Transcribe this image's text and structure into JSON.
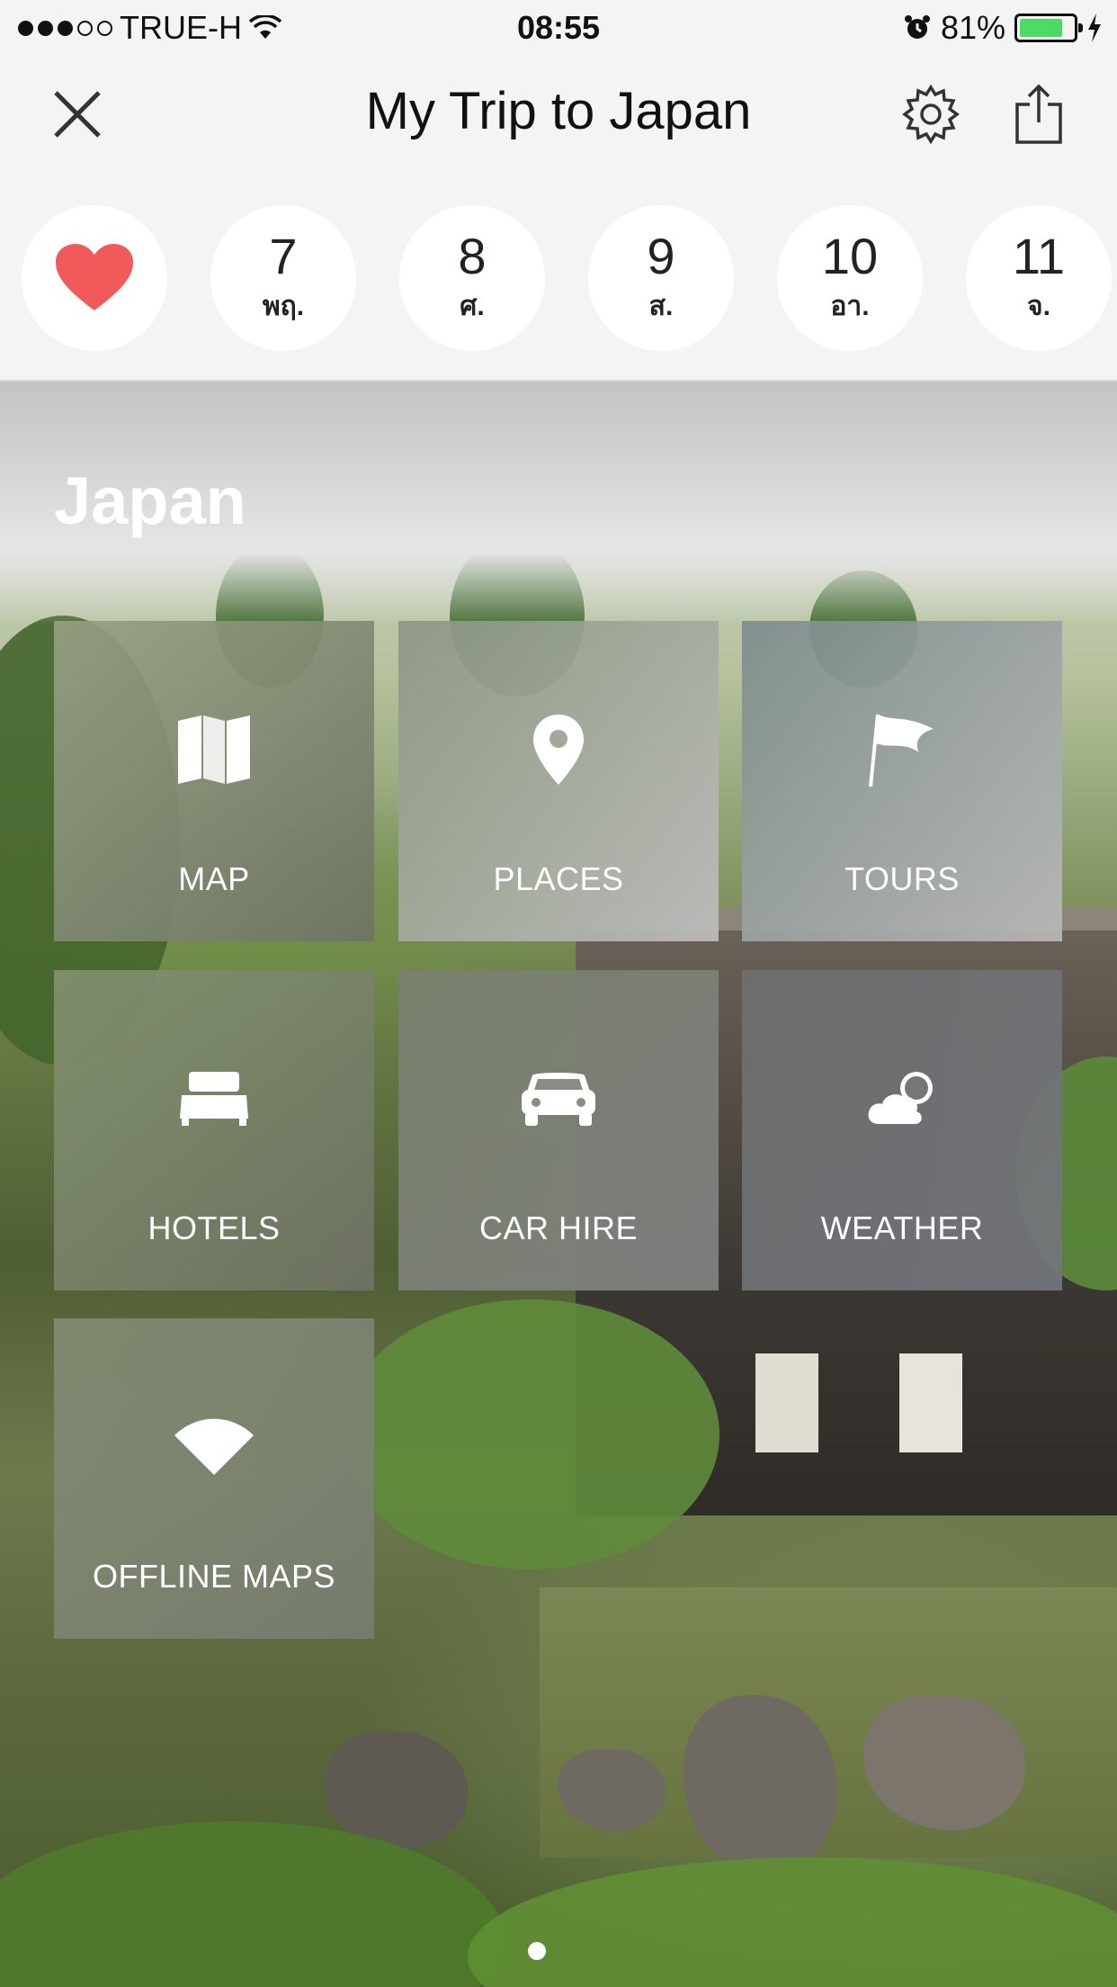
{
  "status_bar": {
    "carrier": "TRUE-H",
    "time": "08:55",
    "battery_percent": "81%",
    "battery_level": 0.81
  },
  "nav": {
    "title": "My Trip to Japan"
  },
  "days": [
    {
      "num": "7",
      "dow": "พฤ."
    },
    {
      "num": "8",
      "dow": "ศ."
    },
    {
      "num": "9",
      "dow": "ส."
    },
    {
      "num": "10",
      "dow": "อา."
    },
    {
      "num": "11",
      "dow": "จ."
    }
  ],
  "hero": {
    "title": "Japan"
  },
  "tiles": [
    {
      "label": "MAP",
      "icon": "map-icon"
    },
    {
      "label": "PLACES",
      "icon": "location-pin-icon"
    },
    {
      "label": "TOURS",
      "icon": "flag-icon"
    },
    {
      "label": "HOTELS",
      "icon": "bed-icon"
    },
    {
      "label": "CAR HIRE",
      "icon": "car-icon"
    },
    {
      "label": "WEATHER",
      "icon": "cloud-sun-icon"
    },
    {
      "label": "OFFLINE MAPS",
      "icon": "wifi-offline-icon"
    }
  ],
  "colors": {
    "heart": "#f05a5a",
    "battery": "#4cd964"
  }
}
